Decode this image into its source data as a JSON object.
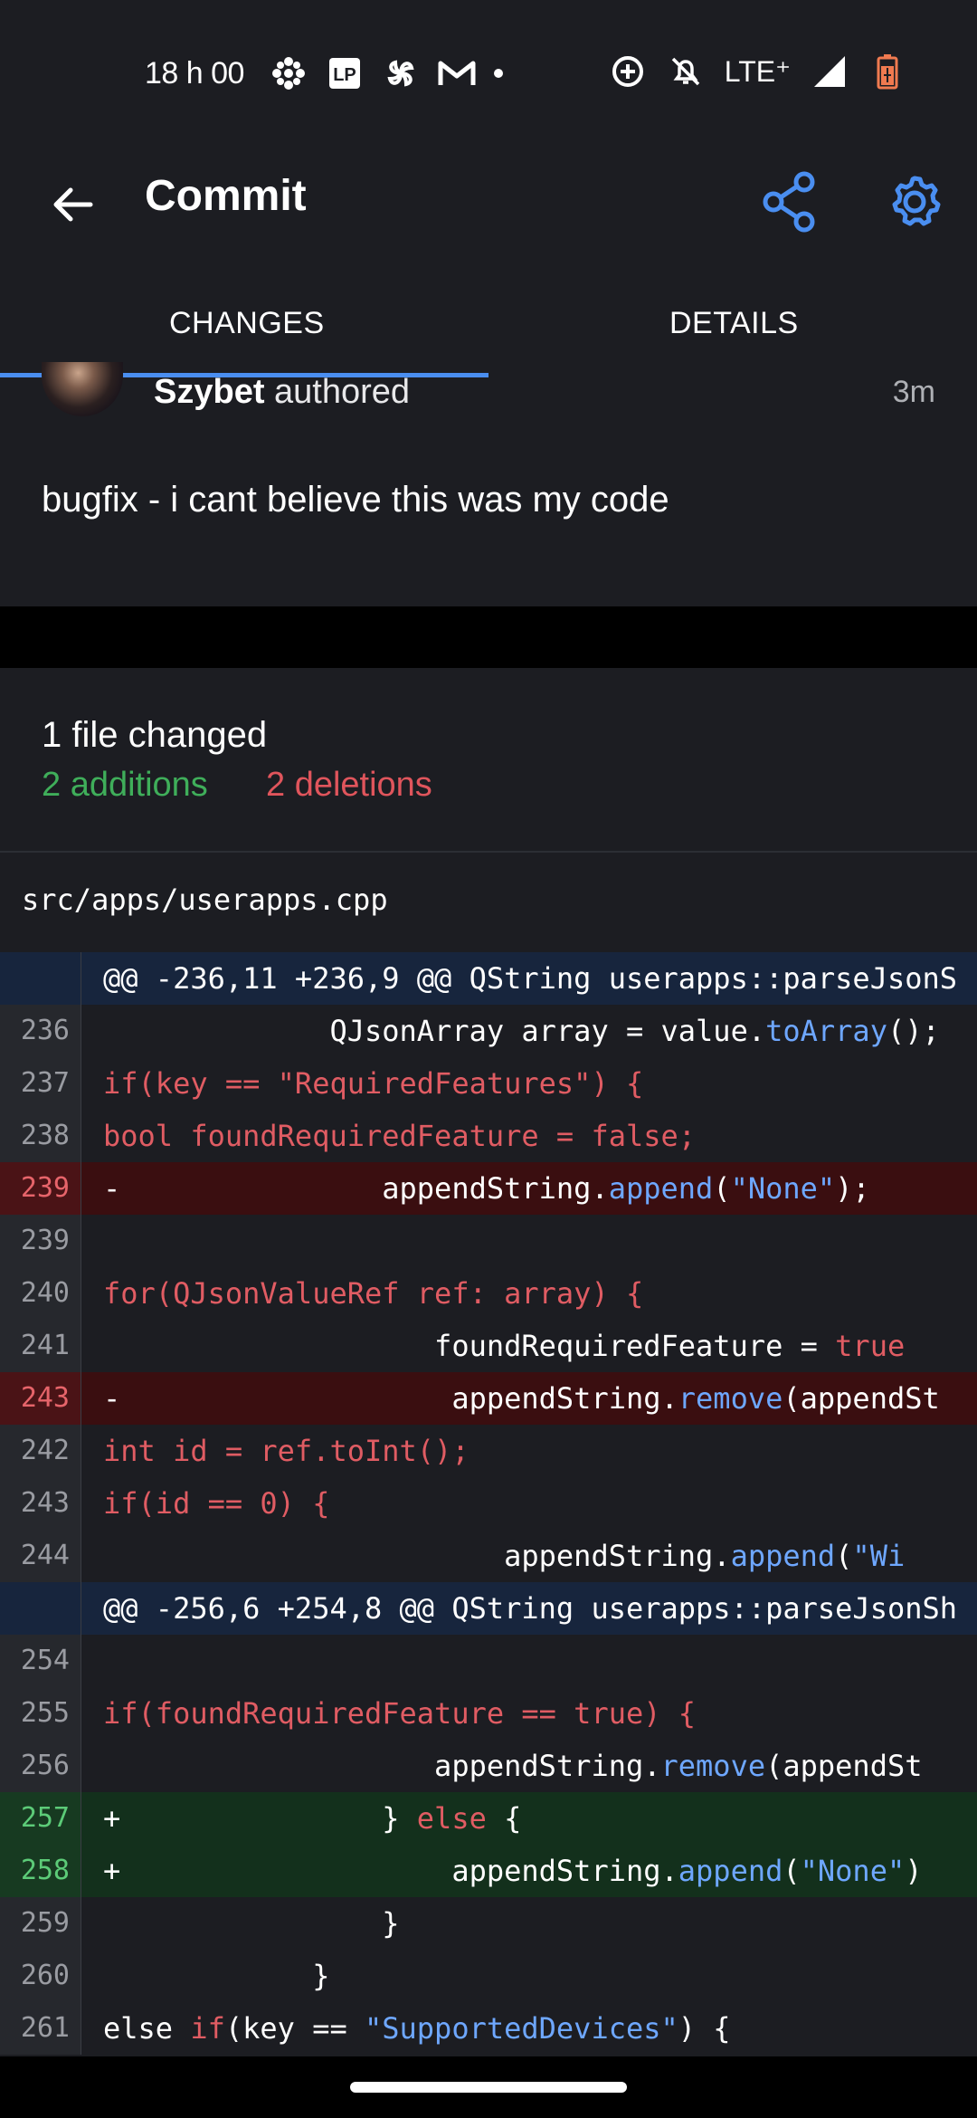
{
  "status": {
    "time": "18 h 00",
    "network": "LTE⁺",
    "left_icons": [
      "cbc-icon",
      "lp-icon",
      "pinwheel-icon",
      "gmail-icon"
    ],
    "right_icons": [
      "data-saver-icon",
      "bell-off-icon",
      "signal-icon",
      "battery-icon"
    ],
    "battery_color": "#f07a50"
  },
  "appbar": {
    "title": "Commit",
    "accent": "#4a8ef0"
  },
  "tabs": [
    {
      "label": "CHANGES",
      "selected": true
    },
    {
      "label": "DETAILS",
      "selected": false
    }
  ],
  "commit": {
    "author": "Szybet",
    "authored_suffix": " authored",
    "age": "3m",
    "message": "bugfix - i cant believe this was my code"
  },
  "summary": {
    "files_changed": "1 file changed",
    "additions": "2 additions",
    "deletions": "2 deletions"
  },
  "file": {
    "path": "src/apps/userapps.cpp"
  },
  "diff": [
    {
      "type": "hunk",
      "line": "",
      "segments": [
        {
          "t": "@@ -236,11 +236,9 @@ QString userapps::parseJsonS",
          "c": ""
        }
      ]
    },
    {
      "type": "ctx",
      "line": "236",
      "segments": [
        {
          "t": "             QJsonArray array = value.",
          "c": ""
        },
        {
          "t": "toArray",
          "c": "blue"
        },
        {
          "t": "();",
          "c": ""
        }
      ]
    },
    {
      "type": "ctx",
      "line": "237",
      "segments": [
        {
          "t": "if(key == \"RequiredFeatures\") {",
          "c": "red"
        }
      ]
    },
    {
      "type": "ctx",
      "line": "238",
      "segments": [
        {
          "t": "bool foundRequiredFeature = false;",
          "c": "red"
        }
      ]
    },
    {
      "type": "del",
      "line": "239",
      "segments": [
        {
          "t": "-               appendString.",
          "c": ""
        },
        {
          "t": "append",
          "c": "blue"
        },
        {
          "t": "(",
          "c": ""
        },
        {
          "t": "\"None\"",
          "c": "blue"
        },
        {
          "t": ");",
          "c": ""
        }
      ]
    },
    {
      "type": "ctx",
      "line": "239",
      "segments": [
        {
          "t": "",
          "c": ""
        }
      ]
    },
    {
      "type": "ctx",
      "line": "240",
      "segments": [
        {
          "t": "for(QJsonValueRef ref: array) {",
          "c": "red"
        }
      ]
    },
    {
      "type": "ctx",
      "line": "241",
      "segments": [
        {
          "t": "                   foundRequiredFeature = ",
          "c": ""
        },
        {
          "t": "true",
          "c": "red"
        }
      ]
    },
    {
      "type": "del",
      "line": "243",
      "segments": [
        {
          "t": "-                   appendString.",
          "c": ""
        },
        {
          "t": "remove",
          "c": "blue"
        },
        {
          "t": "(appendSt",
          "c": ""
        }
      ]
    },
    {
      "type": "ctx",
      "line": "242",
      "segments": [
        {
          "t": "int id = ref.toInt();",
          "c": "red"
        }
      ]
    },
    {
      "type": "ctx",
      "line": "243",
      "segments": [
        {
          "t": "if(id == 0) {",
          "c": "red"
        }
      ]
    },
    {
      "type": "ctx",
      "line": "244",
      "segments": [
        {
          "t": "                       appendString.",
          "c": ""
        },
        {
          "t": "append",
          "c": "blue"
        },
        {
          "t": "(",
          "c": ""
        },
        {
          "t": "\"Wi",
          "c": "blue"
        }
      ]
    },
    {
      "type": "hunk",
      "line": "",
      "segments": [
        {
          "t": "@@ -256,6 +254,8 @@ QString userapps::parseJsonSh",
          "c": ""
        }
      ]
    },
    {
      "type": "ctx",
      "line": "254",
      "segments": [
        {
          "t": "",
          "c": ""
        }
      ]
    },
    {
      "type": "ctx",
      "line": "255",
      "segments": [
        {
          "t": "if(foundRequiredFeature == true) {",
          "c": "red"
        }
      ]
    },
    {
      "type": "ctx",
      "line": "256",
      "segments": [
        {
          "t": "                   appendString.",
          "c": ""
        },
        {
          "t": "remove",
          "c": "blue"
        },
        {
          "t": "(appendSt",
          "c": ""
        }
      ]
    },
    {
      "type": "add",
      "line": "257",
      "segments": [
        {
          "t": "+               } ",
          "c": ""
        },
        {
          "t": "else",
          "c": "red"
        },
        {
          "t": " {",
          "c": ""
        }
      ]
    },
    {
      "type": "add",
      "line": "258",
      "segments": [
        {
          "t": "+                   appendString.",
          "c": ""
        },
        {
          "t": "append",
          "c": "blue"
        },
        {
          "t": "(",
          "c": ""
        },
        {
          "t": "\"None\"",
          "c": "blue"
        },
        {
          "t": ")",
          "c": ""
        }
      ]
    },
    {
      "type": "ctx",
      "line": "259",
      "segments": [
        {
          "t": "                }",
          "c": ""
        }
      ]
    },
    {
      "type": "ctx",
      "line": "260",
      "segments": [
        {
          "t": "            }",
          "c": ""
        }
      ]
    },
    {
      "type": "ctx",
      "line": "261",
      "segments": [
        {
          "t": "else ",
          "c": ""
        },
        {
          "t": "if",
          "c": "red"
        },
        {
          "t": "(key == ",
          "c": ""
        },
        {
          "t": "\"SupportedDevices\"",
          "c": "blue"
        },
        {
          "t": ") {",
          "c": ""
        }
      ]
    }
  ]
}
